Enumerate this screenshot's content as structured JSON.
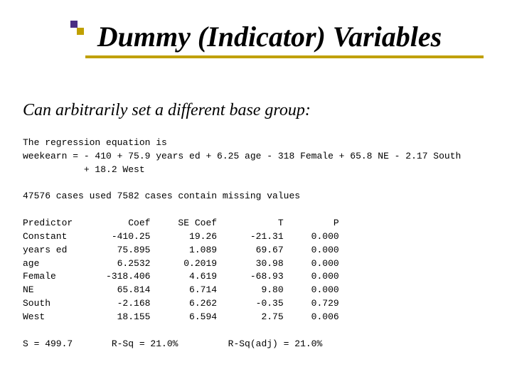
{
  "title": "Dummy (Indicator) Variables",
  "subtitle": "Can arbitrarily set a different base group:",
  "regression": {
    "intro": "The regression equation is",
    "eq_line1": "weekearn = - 410 + 75.9 years ed + 6.25 age - 318 Female + 65.8 NE - 2.17 South",
    "eq_line2": "           + 18.2 West"
  },
  "cases_line": "47576 cases used 7582 cases contain missing values",
  "table": {
    "header": {
      "c0": "Predictor",
      "c1": "Coef",
      "c2": "SE Coef",
      "c3": "T",
      "c4": "P"
    },
    "rows": [
      {
        "c0": "Constant",
        "c1": "-410.25",
        "c2": "19.26",
        "c3": "-21.31",
        "c4": "0.000"
      },
      {
        "c0": "years ed",
        "c1": "75.895",
        "c2": "1.089",
        "c3": "69.67",
        "c4": "0.000"
      },
      {
        "c0": "age",
        "c1": "6.2532",
        "c2": "0.2019",
        "c3": "30.98",
        "c4": "0.000"
      },
      {
        "c0": "Female",
        "c1": "-318.406",
        "c2": "4.619",
        "c3": "-68.93",
        "c4": "0.000"
      },
      {
        "c0": "NE",
        "c1": "65.814",
        "c2": "6.714",
        "c3": "9.80",
        "c4": "0.000"
      },
      {
        "c0": "South",
        "c1": "-2.168",
        "c2": "6.262",
        "c3": "-0.35",
        "c4": "0.729"
      },
      {
        "c0": "West",
        "c1": "18.155",
        "c2": "6.594",
        "c3": "2.75",
        "c4": "0.006"
      }
    ]
  },
  "footer": {
    "s_label": "S = ",
    "s_value": "499.7",
    "rsq_label": "R-Sq = ",
    "rsq_value": "21.0%",
    "rsqadj_label": "R-Sq(adj) = ",
    "rsqadj_value": "21.0%"
  },
  "chart_data": {
    "type": "table",
    "title": "Regression coefficients",
    "columns": [
      "Predictor",
      "Coef",
      "SE Coef",
      "T",
      "P"
    ],
    "rows": [
      [
        "Constant",
        -410.25,
        19.26,
        -21.31,
        0.0
      ],
      [
        "years ed",
        75.895,
        1.089,
        69.67,
        0.0
      ],
      [
        "age",
        6.2532,
        0.2019,
        30.98,
        0.0
      ],
      [
        "Female",
        -318.406,
        4.619,
        -68.93,
        0.0
      ],
      [
        "NE",
        65.814,
        6.714,
        9.8,
        0.0
      ],
      [
        "South",
        -2.168,
        6.262,
        -0.35,
        0.729
      ],
      [
        "West",
        18.155,
        6.594,
        2.75,
        0.006
      ]
    ],
    "summary": {
      "S": 499.7,
      "R_Sq": "21.0%",
      "R_Sq_adj": "21.0%",
      "n_used": 47576,
      "n_missing": 7582
    }
  }
}
